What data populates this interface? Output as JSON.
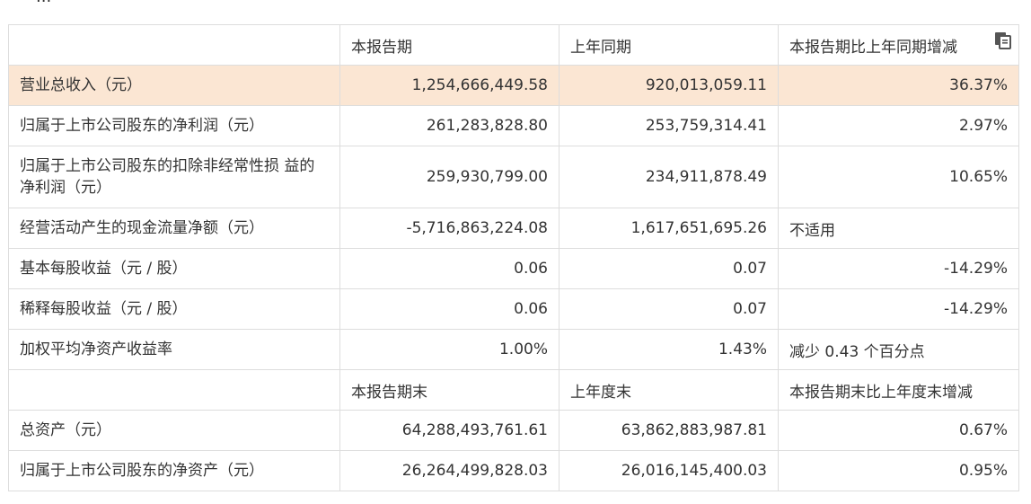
{
  "top_fragment": "...",
  "header": {
    "label": "",
    "current": "本报告期",
    "prior": "上年同期",
    "change": "本报告期比上年同期增减"
  },
  "rows": [
    {
      "label": "营业总收入（元）",
      "current": "1,254,666,449.58",
      "prior": "920,013,059.11",
      "change": "36.37%"
    },
    {
      "label": "归属于上市公司股东的净利润（元）",
      "current": "261,283,828.80",
      "prior": "253,759,314.41",
      "change": "2.97%"
    },
    {
      "label": "归属于上市公司股东的扣除非经常性损 益的净利润（元）",
      "current": "259,930,799.00",
      "prior": "234,911,878.49",
      "change": "10.65%"
    },
    {
      "label": "经营活动产生的现金流量净额（元）",
      "current": "-5,716,863,224.08",
      "prior": "1,617,651,695.26",
      "change": "不适用"
    },
    {
      "label": "基本每股收益（元 / 股）",
      "current": "0.06",
      "prior": "0.07",
      "change": "-14.29%"
    },
    {
      "label": "稀释每股收益（元 / 股）",
      "current": "0.06",
      "prior": "0.07",
      "change": "-14.29%"
    },
    {
      "label": "加权平均净资产收益率",
      "current": "1.00%",
      "prior": "1.43%",
      "change": "减少 0.43 个百分点"
    }
  ],
  "header2": {
    "label": "",
    "current": "本报告期末",
    "prior": "上年度末",
    "change": "本报告期末比上年度末增减"
  },
  "rows2": [
    {
      "label": "总资产（元）",
      "current": "64,288,493,761.61",
      "prior": "63,862,883,987.81",
      "change": "0.67%"
    },
    {
      "label": "归属于上市公司股东的净资产（元）",
      "current": "26,264,499,828.03",
      "prior": "26,016,145,400.03",
      "change": "0.95%"
    }
  ],
  "colors": {
    "highlight_row": "#fbe6d3",
    "border": "#dddddd",
    "text": "#333333"
  },
  "icons": {
    "copy": "copy-icon"
  }
}
